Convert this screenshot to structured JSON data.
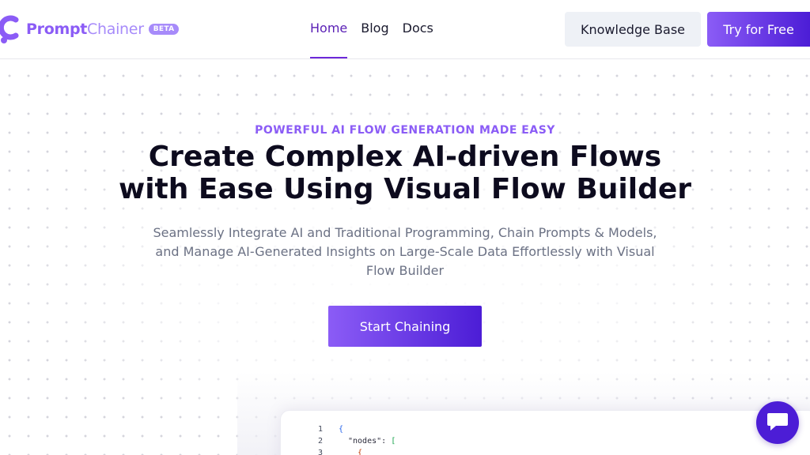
{
  "brand": {
    "name_part1": "Prompt",
    "name_part2": "Chainer",
    "badge": "BETA"
  },
  "nav": {
    "items": [
      {
        "label": "Home",
        "active": true
      },
      {
        "label": "Blog",
        "active": false
      },
      {
        "label": "Docs",
        "active": false
      }
    ]
  },
  "header_actions": {
    "knowledge_base": "Knowledge Base",
    "try_free": "Try for Free"
  },
  "hero": {
    "eyebrow": "POWERFUL AI FLOW GENERATION MADE EASY",
    "headline_line1": "Create Complex AI-driven Flows",
    "headline_line2": "with Ease Using Visual Flow Builder",
    "subtitle_line1": "Seamlessly Integrate AI and Traditional Programming, Chain Prompts & Models,",
    "subtitle_line2": "and Manage AI-Generated Insights on Large-Scale Data Effortlessly with Visual",
    "subtitle_line3": "Flow Builder",
    "cta": "Start Chaining"
  },
  "code_preview": {
    "lines": [
      {
        "num": "1",
        "text": "{"
      },
      {
        "num": "2",
        "key": "\"nodes\"",
        "sep": ": ",
        "bracket": "["
      },
      {
        "num": "3",
        "text": "{"
      }
    ]
  },
  "icons": {
    "logo": "promptchainer-logo-icon",
    "chat": "chat-bubble-icon"
  },
  "colors": {
    "brand_purple": "#8b5cf6",
    "brand_deep": "#4c1dd6",
    "active_nav": "#5b21b6"
  }
}
